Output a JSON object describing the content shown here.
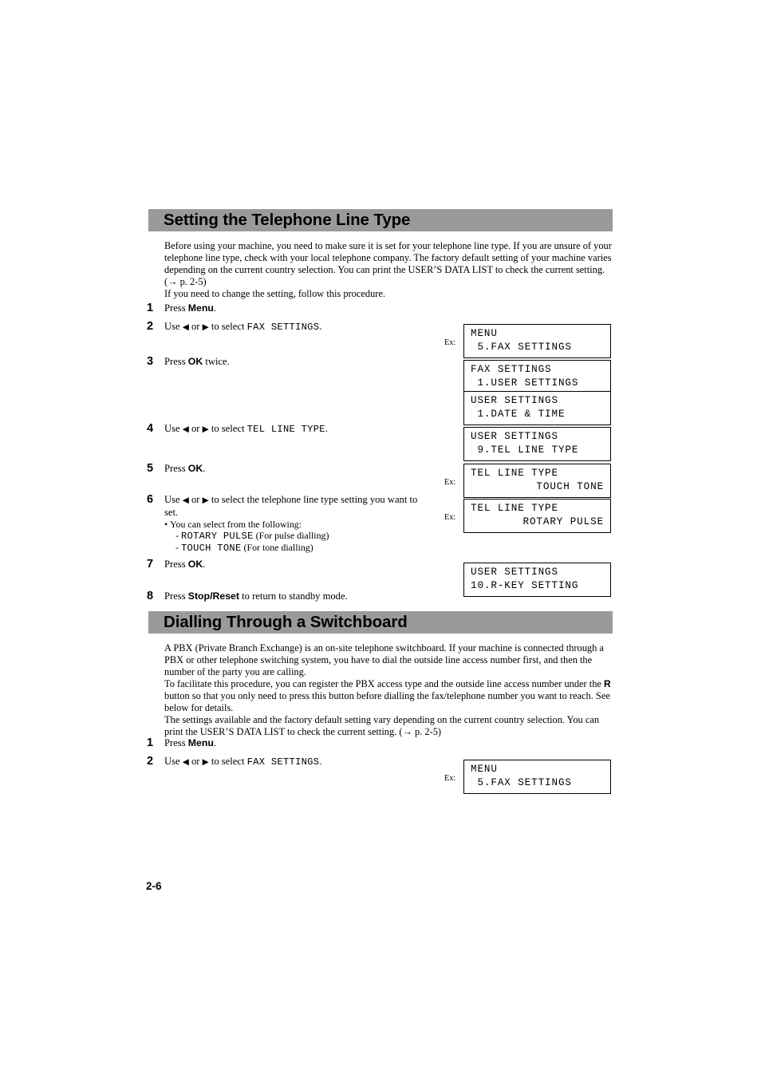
{
  "page": {
    "folio": "2-6"
  },
  "sections": [
    {
      "heading": "Setting the Telephone Line Type",
      "intro_paragraphs": [
        "Before using your machine, you need to make sure it is set for your telephone line type. If you are unsure of your telephone line type, check with your local telephone company. The factory default setting of your machine varies depending on the current country selection. You can print the USER’S DATA LIST to check the current setting. (→ p. 2-5)",
        "If you need to change the setting, follow this procedure."
      ],
      "steps": [
        {
          "num": "1",
          "pre": "Press ",
          "bold": "Menu",
          "post": "."
        },
        {
          "num": "2",
          "pre": "Use ",
          "arrows": true,
          "mid": " to select ",
          "mono": "FAX SETTINGS",
          "post": "."
        },
        {
          "num": "3",
          "pre": "Press ",
          "bold": "OK",
          "post": " twice."
        },
        {
          "num": "4",
          "pre": "Use ",
          "arrows": true,
          "mid": " to select ",
          "mono": "TEL LINE TYPE",
          "post": "."
        },
        {
          "num": "5",
          "pre": "Press ",
          "bold": "OK",
          "post": "."
        },
        {
          "num": "6",
          "pre": "Use ",
          "arrows": true,
          "mid": " to select the telephone line type setting you want to set."
        },
        {
          "num": "7",
          "pre": "Press ",
          "bold": "OK",
          "post": "."
        },
        {
          "num": "8",
          "pre": "Press ",
          "bold": "Stop/Reset",
          "post": " to return to standby mode."
        }
      ],
      "step6_sublist": {
        "bullet": "You can select from the following:",
        "items": [
          {
            "mono": "ROTARY PULSE",
            "note": " (For pulse dialling)"
          },
          {
            "mono": "TOUCH TONE",
            "note": " (For tone dialling)"
          }
        ]
      }
    },
    {
      "heading": "Dialling Through a Switchboard",
      "intro_paragraphs": [
        "A PBX (Private Branch Exchange) is an on-site telephone switchboard. If your machine is connected through a PBX or other telephone switching system, you have to dial the outside line access number first, and then the number of the party you are calling.",
        "To facilitate this procedure, you can register the PBX access type and the outside line access number under the R button so that you only need to press this button before dialling the fax/telephone number you want to reach. See below for details.",
        "The settings available and the factory default setting vary depending on the current country selection. You can print the USER’S DATA LIST to check the current setting. (→ p. 2-5)"
      ],
      "steps": [
        {
          "num": "1",
          "pre": "Press ",
          "bold": "Menu",
          "post": "."
        },
        {
          "num": "2",
          "pre": "Use ",
          "arrows": true,
          "mid": " to select ",
          "mono": "FAX SETTINGS",
          "post": "."
        }
      ]
    }
  ],
  "lcd_examples": [
    {
      "id": "lcd-menu-fax-settings",
      "ex": "Ex:",
      "line1": "MENU",
      "line2": " 5.FAX SETTINGS",
      "align2": "left"
    },
    {
      "id": "lcd-fax-user-settings",
      "ex": "",
      "line1": "FAX SETTINGS",
      "line2": " 1.USER SETTINGS",
      "align2": "left"
    },
    {
      "id": "lcd-user-date-time",
      "ex": "",
      "line1": "USER SETTINGS",
      "line2": " 1.DATE & TIME",
      "align2": "left"
    },
    {
      "id": "lcd-user-tel-line-type",
      "ex": "",
      "line1": "USER SETTINGS",
      "line2": " 9.TEL LINE TYPE",
      "align2": "left"
    },
    {
      "id": "lcd-tel-line-touch-tone",
      "ex": "Ex:",
      "line1": "TEL LINE TYPE",
      "line2": "TOUCH TONE",
      "align2": "right"
    },
    {
      "id": "lcd-tel-line-rotary-pulse",
      "ex": "Ex:",
      "line1": "TEL LINE TYPE",
      "line2": "ROTARY PULSE",
      "align2": "right"
    },
    {
      "id": "lcd-user-r-key-setting",
      "ex": "",
      "line1": "USER SETTINGS",
      "line2": "10.R-KEY SETTING",
      "align2": "left"
    },
    {
      "id": "lcd-menu-fax-settings-2",
      "ex": "Ex:",
      "line1": "MENU",
      "line2": " 5.FAX SETTINGS",
      "align2": "left"
    }
  ],
  "glyphs": {
    "left_triangle": "◀",
    "right_triangle": "▶",
    "bullet": "•",
    "dash": "-",
    "or": " or "
  },
  "colors": {
    "heading_bar": "#9a9a9a",
    "text": "#000000",
    "page_background": "#ffffff"
  }
}
